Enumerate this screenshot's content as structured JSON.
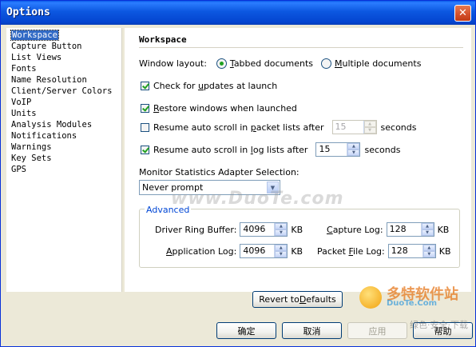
{
  "window": {
    "title": "Options",
    "close_glyph": "✕"
  },
  "nav": {
    "items": [
      {
        "label": "Workspace",
        "selected": true
      },
      {
        "label": "Capture Button"
      },
      {
        "label": "List Views"
      },
      {
        "label": "Fonts"
      },
      {
        "label": "Name Resolution"
      },
      {
        "label": "Client/Server Colors"
      },
      {
        "label": "VoIP"
      },
      {
        "label": "Units"
      },
      {
        "label": "Analysis Modules"
      },
      {
        "label": "Notifications"
      },
      {
        "label": "Warnings"
      },
      {
        "label": "Key Sets"
      },
      {
        "label": "GPS"
      }
    ]
  },
  "panel": {
    "title": "Workspace",
    "window_layout": {
      "label": "Window layout:",
      "tabbed_pre": "",
      "tabbed_key": "T",
      "tabbed_post": "abbed documents",
      "multiple_pre": "",
      "multiple_key": "M",
      "multiple_post": "ultiple documents",
      "selected": "tabbed"
    },
    "check_updates": {
      "pre": "Check for ",
      "key": "u",
      "post": "pdates at launch",
      "checked": true
    },
    "restore_windows": {
      "pre": "",
      "key": "R",
      "post": "estore windows when launched",
      "checked": true
    },
    "auto_scroll_packet": {
      "pre": "Resume auto scroll in ",
      "key": "p",
      "post": "acket lists after",
      "checked": false,
      "value": "15",
      "unit": "seconds"
    },
    "auto_scroll_log": {
      "pre": "Resume auto scroll in ",
      "key": "l",
      "post": "og lists after",
      "checked": true,
      "value": "15",
      "unit": "seconds"
    },
    "monitor_stats": {
      "label": "Monitor Statistics Adapter Selection:",
      "selected": "Never prompt"
    },
    "advanced": {
      "legend": "Advanced",
      "driver_ring_buffer": {
        "label": "Driver Ring Buffer:",
        "value": "4096",
        "unit": "KB"
      },
      "application_log": {
        "label_pre": "",
        "label_key": "A",
        "label_post": "pplication Log:",
        "value": "4096",
        "unit": "KB"
      },
      "capture_log": {
        "label_pre": "",
        "label_key": "C",
        "label_post": "apture Log:",
        "value": "128",
        "unit": "KB"
      },
      "packet_file_log": {
        "label_pre": "Packet ",
        "label_key": "F",
        "label_post": "ile Log:",
        "value": "128",
        "unit": "KB"
      }
    },
    "revert_button": {
      "pre": "Revert to ",
      "key": "D",
      "post": "efaults"
    }
  },
  "footer": {
    "ok": "确定",
    "cancel": "取消",
    "apply": "应用",
    "help": "帮助"
  },
  "watermarks": {
    "center": "www.DuoTe.com",
    "logo_main": "多特软件站",
    "logo_sub": "DuoTe.Com",
    "bottom": "绿色·安全·下载"
  }
}
